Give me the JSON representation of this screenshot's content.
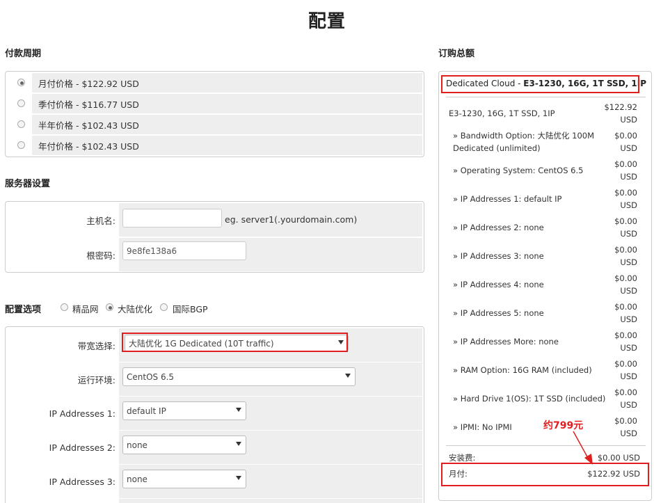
{
  "page": {
    "title": "配置"
  },
  "billing": {
    "title": "付款周期",
    "options": [
      {
        "label": "月付价格 - $122.92 USD",
        "checked": true
      },
      {
        "label": "季付价格 - $116.77 USD",
        "checked": false
      },
      {
        "label": "半年价格 - $102.43 USD",
        "checked": false
      },
      {
        "label": "年付价格 - $102.43 USD",
        "checked": false
      }
    ]
  },
  "server": {
    "title": "服务器设置",
    "hostname_label": "主机名:",
    "hostname_value": "",
    "hostname_hint": "eg. server1(.yourdomain.com)",
    "rootpw_label": "根密码:",
    "rootpw_value": "9e8fe138a6"
  },
  "config": {
    "title": "配置选项",
    "network_options": [
      {
        "label": "精品网",
        "checked": false
      },
      {
        "label": "大陆优化",
        "checked": true
      },
      {
        "label": "国际BGP",
        "checked": false
      }
    ],
    "rows": [
      {
        "label": "带宽选择:",
        "value": "大陆优化 1G Dedicated (10T traffic)"
      },
      {
        "label": "运行环境:",
        "value": "CentOS 6.5"
      },
      {
        "label": "IP Addresses 1:",
        "value": "default IP"
      },
      {
        "label": "IP Addresses 2:",
        "value": "none"
      },
      {
        "label": "IP Addresses 3:",
        "value": "none"
      }
    ]
  },
  "summary": {
    "title": "订购总额",
    "product_prefix": "Dedicated Cloud - ",
    "product_bold": "E3-1230, 16G, 1T SSD, 1IP",
    "lines": [
      {
        "label": "E3-1230, 16G, 1T SSD, 1IP",
        "price": "$122.92",
        "unit": "USD"
      },
      {
        "label": "» Bandwidth Option: 大陆优化 100M",
        "label2": "Dedicated (unlimited)",
        "price": "$0.00",
        "unit": "USD"
      },
      {
        "label": "» Operating System: CentOS 6.5",
        "price": "$0.00",
        "unit": "USD"
      },
      {
        "label": "» IP Addresses 1: default IP",
        "price": "$0.00",
        "unit": "USD"
      },
      {
        "label": "» IP Addresses 2: none",
        "price": "$0.00",
        "unit": "USD"
      },
      {
        "label": "» IP Addresses 3: none",
        "price": "$0.00",
        "unit": "USD"
      },
      {
        "label": "» IP Addresses 4: none",
        "price": "$0.00",
        "unit": "USD"
      },
      {
        "label": "» IP Addresses 5: none",
        "price": "$0.00",
        "unit": "USD"
      },
      {
        "label": "» IP Addresses More: none",
        "price": "$0.00",
        "unit": "USD"
      },
      {
        "label": "» RAM Option: 16G RAM (included)",
        "price": "$0.00",
        "unit": "USD"
      },
      {
        "label": "» Hard Drive 1(OS): 1T SSD (included)",
        "price": "$0.00",
        "unit": "USD"
      },
      {
        "label": "» IPMI: No IPMI",
        "price": "$0.00",
        "unit": "USD"
      }
    ],
    "setup_label": "安装费:",
    "setup_price": "$0.00 USD",
    "monthly_label": "月付:",
    "monthly_price": "$122.92 USD",
    "annotation": "约799元"
  },
  "colors": {
    "highlight": "#e01e1e",
    "row_bg": "#eeeeee",
    "border": "#cccccc"
  }
}
